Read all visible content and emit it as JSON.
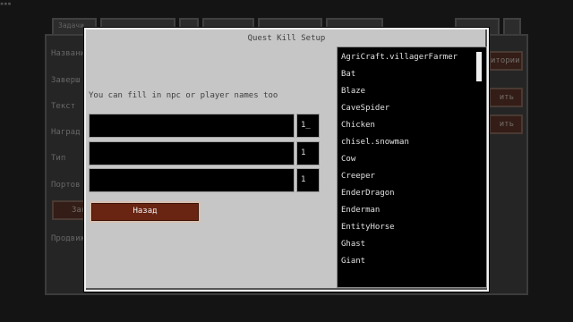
{
  "background": {
    "corner": "▪▪▪",
    "tabs": [
      "Задачи",
      "",
      "",
      "",
      "",
      "",
      "",
      ""
    ],
    "labels": [
      "Названи",
      "Заверш",
      "Текст",
      "Наград",
      "Тип",
      "Портов",
      "",
      "Продвиж"
    ],
    "buttons": [
      "итории",
      "ить",
      "ить",
      "Зак"
    ]
  },
  "dialog": {
    "title": "Quest Kill Setup",
    "hint": "You can fill in npc or player names too",
    "rows": [
      {
        "name": "",
        "count": "1_"
      },
      {
        "name": "",
        "count": "1"
      },
      {
        "name": "",
        "count": "1"
      }
    ],
    "back_label": "Назад",
    "entities": [
      "AgriCraft.villagerFarmer",
      "Bat",
      "Blaze",
      "CaveSpider",
      "Chicken",
      "chisel.snowman",
      "Cow",
      "Creeper",
      "EnderDragon",
      "Enderman",
      "EntityHorse",
      "Ghast",
      "Giant"
    ]
  }
}
